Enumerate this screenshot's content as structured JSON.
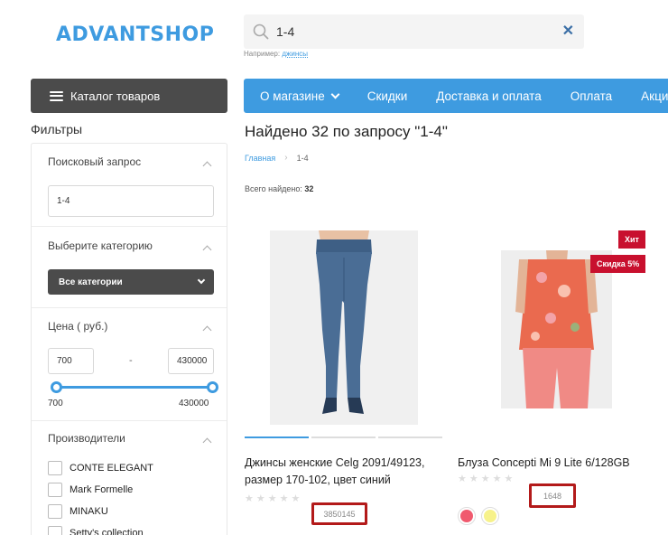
{
  "header": {
    "logo": "ADVANTSHOP",
    "search": {
      "value": "1-4",
      "hint_prefix": "Например:",
      "hint_example": "джинсы"
    }
  },
  "catalog_button": {
    "label": "Каталог товаров"
  },
  "nav": {
    "items": [
      "О магазине",
      "Скидки",
      "Доставка и оплата",
      "Оплата",
      "Акции"
    ]
  },
  "filters": {
    "title": "Фильтры",
    "query": {
      "title": "Поисковый запрос",
      "value": "1-4"
    },
    "category": {
      "title": "Выберите категорию",
      "selected": "Все категории"
    },
    "price": {
      "title": "Цена ( руб.)",
      "min": "700",
      "max": "430000",
      "dash": "-",
      "range_min_label": "700",
      "range_max_label": "430000"
    },
    "brands": {
      "title": "Производители",
      "items": [
        "CONTE ELEGANT",
        "Mark Formelle",
        "MINAKU",
        "Setty's collection"
      ]
    }
  },
  "results": {
    "title": "Найдено 32 по запросу \"1-4\"",
    "breadcrumb": {
      "home": "Главная",
      "current": "1-4"
    },
    "total_label": "Всего найдено:",
    "total_count": "32"
  },
  "products": [
    {
      "name_line1": "Джинсы женские Celg 2091/49123,",
      "name_line2": "размер 170-102, цвет синий",
      "sku": "3850145",
      "rating": 0
    },
    {
      "name_line1": "Блуза Concepti Mi 9 Lite 6/128GB",
      "sku": "1648",
      "rating": 0,
      "badges": [
        "Хит",
        "Скидка 5%"
      ],
      "color_swatches": [
        "#f05a6e",
        "#f7f28a"
      ]
    }
  ],
  "colors": {
    "accent": "#3e9be0",
    "dark_button": "#4b4b4b",
    "badge": "#c8102e",
    "highlight_box": "#b31a1a"
  }
}
